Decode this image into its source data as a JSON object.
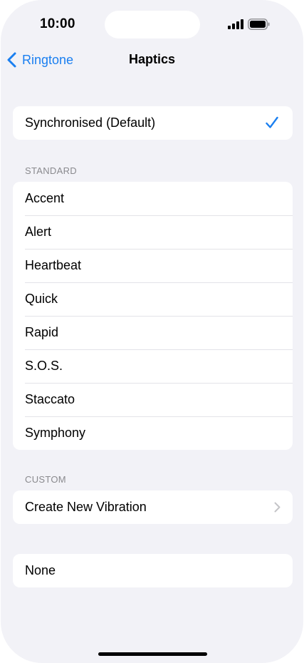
{
  "status_bar": {
    "time": "10:00"
  },
  "nav": {
    "back_label": "Ringtone",
    "title": "Haptics"
  },
  "sync_group": {
    "label": "Synchronised (Default)",
    "selected": true
  },
  "standard": {
    "header": "STANDARD",
    "items": [
      "Accent",
      "Alert",
      "Heartbeat",
      "Quick",
      "Rapid",
      "S.O.S.",
      "Staccato",
      "Symphony"
    ]
  },
  "custom": {
    "header": "CUSTOM",
    "create_label": "Create New Vibration"
  },
  "none_label": "None",
  "colors": {
    "accent": "#1a7ff0",
    "background": "#f2f2f7",
    "secondary_text": "#8a8a8e"
  }
}
